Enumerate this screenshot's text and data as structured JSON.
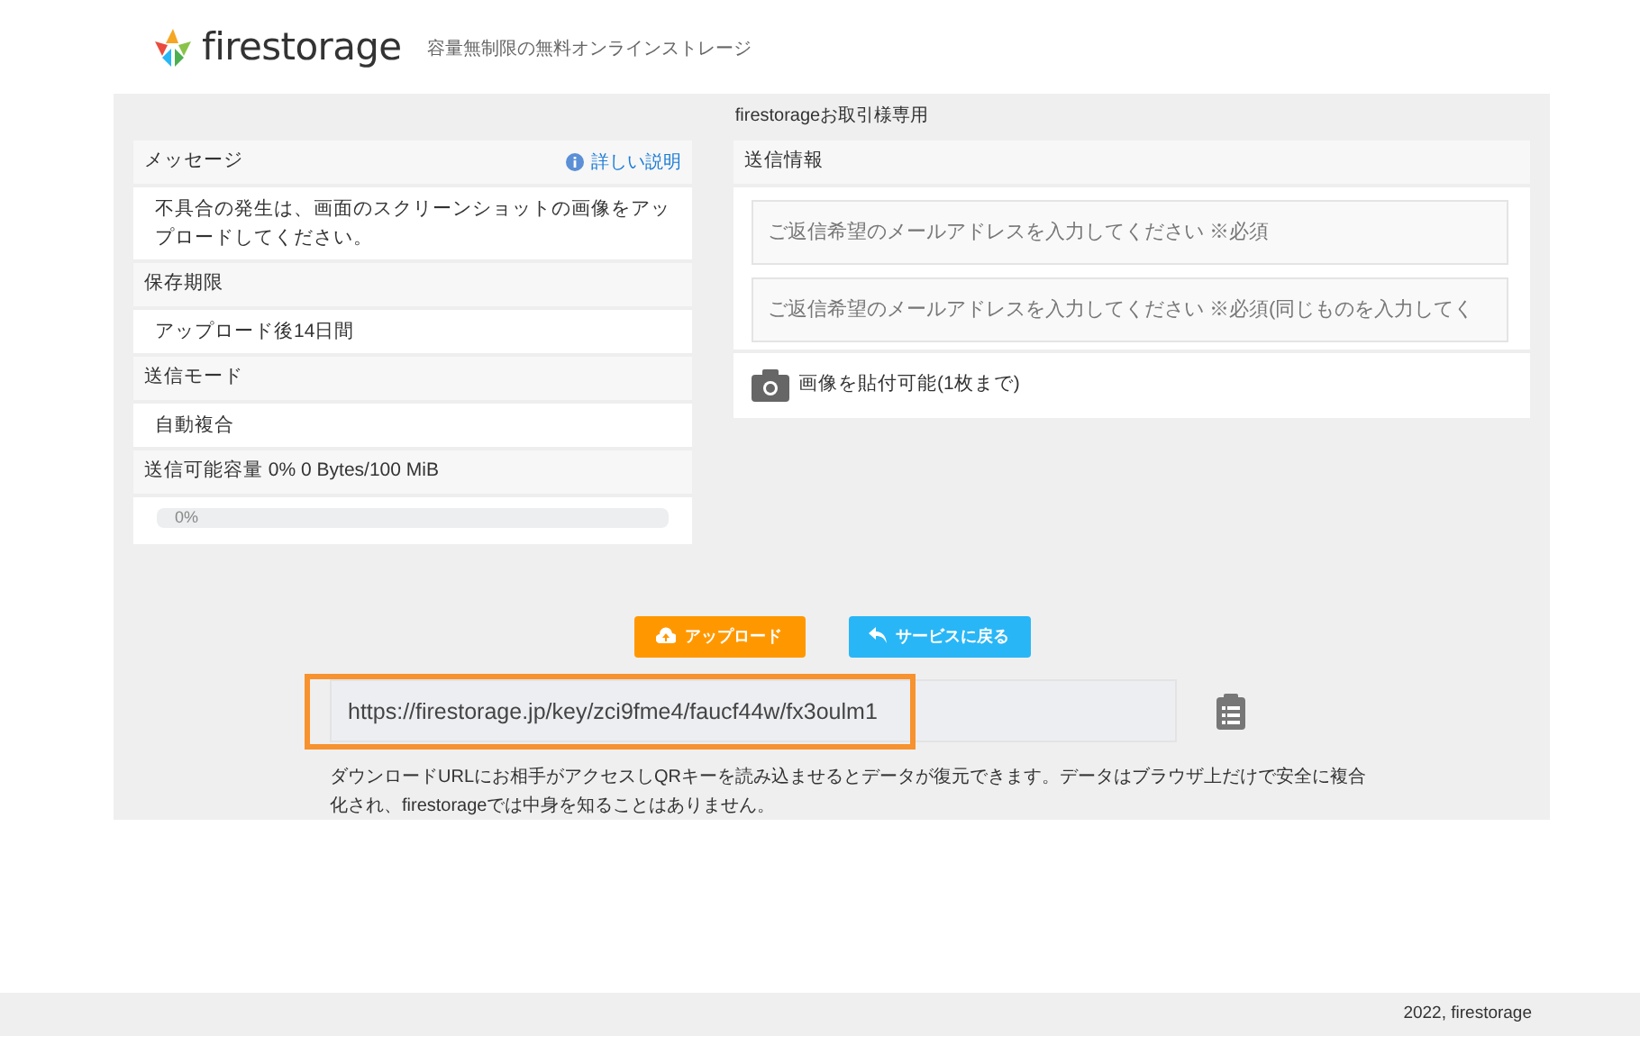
{
  "header": {
    "brand": "firestorage",
    "tagline": "容量無制限の無料オンラインストレージ"
  },
  "panel_title": "firestorageお取引様専用",
  "info": {
    "sections": [
      {
        "heading": "メッセージ",
        "link": "詳しい説明",
        "body": "不具合の発生は、画面のスクリーンショットの画像をアップロードしてください。"
      },
      {
        "heading": "保存期限",
        "body": "アップロード後14日間"
      },
      {
        "heading": "送信モード",
        "body": "自動複合"
      },
      {
        "heading": "送信可能容量 0% 0 Bytes/100 MiB",
        "progress": {
          "level": 0,
          "label": "0%"
        }
      }
    ]
  },
  "send": {
    "heading": "送信情報",
    "fields": [
      {
        "placeholder": "ご返信希望のメールアドレスを入力してください ※必須"
      },
      {
        "placeholder": "ご返信希望のメールアドレスを入力してください ※必須(同じものを入力してく"
      }
    ],
    "attach_note": "画像を貼付可能(1枚まで)"
  },
  "buttons": [
    {
      "kind": "upload",
      "label": "アップロード"
    },
    {
      "kind": "back",
      "label": "サービスに戻る"
    }
  ],
  "url": {
    "value": "https://firestorage.jp/key/zci9fme4/faucf44w/fx3oulm1",
    "highlighted": true
  },
  "notice": "ダウンロードURLにお相手がアクセスしQRキーを読み込ませるとデータが復元できます。データはブラウザ上だけで安全に複合化され、firestorageでは中身を知ることはありません。",
  "footer": "2022, firestorage"
}
